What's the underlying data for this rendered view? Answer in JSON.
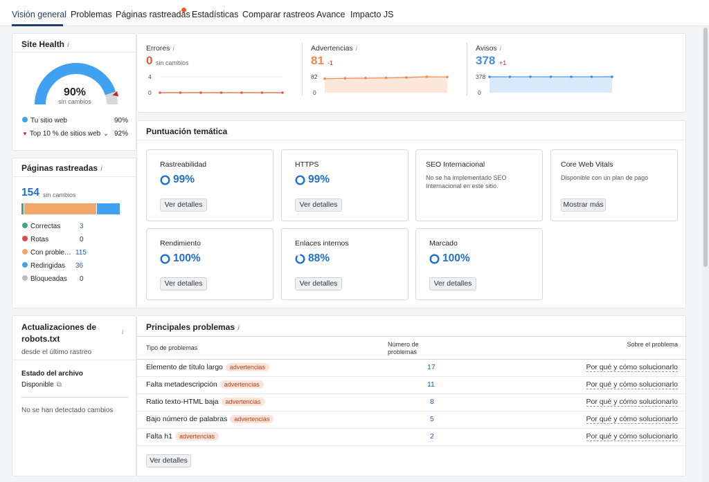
{
  "nav": {
    "tabs": [
      "Visión general",
      "Problemas",
      "Páginas rastreadas",
      "Estadísticas",
      "Comparar rastreos",
      "Avance",
      "Impacto JS"
    ]
  },
  "site_health": {
    "title": "Site Health",
    "info": "i",
    "value": "90%",
    "caption": "sin cambios",
    "your_site_label": "Tu sitio web",
    "your_site_value": "90%",
    "top10_label": "Top 10 % de sitios web",
    "top10_value": "92%",
    "gauge_fraction": 0.9,
    "colors": {
      "gauge": "#3fa1ef",
      "rest": "#d8d8d8",
      "marker": "#c9262c"
    }
  },
  "crawled_pages": {
    "title": "Páginas rastreadas",
    "info": "i",
    "total": "154",
    "caption": "sin cambios",
    "items": [
      {
        "label": "Correctas",
        "value": "3",
        "color": "#3ea67a",
        "link": true
      },
      {
        "label": "Rotas",
        "value": "0",
        "color": "#d94a4a",
        "link": false
      },
      {
        "label": "Con proble…",
        "value": "115",
        "color": "#f1a66c",
        "link": true
      },
      {
        "label": "Redirigidas",
        "value": "36",
        "color": "#3fa1ef",
        "link": true
      },
      {
        "label": "Bloqueadas",
        "value": "0",
        "color": "#bdbdbd",
        "link": false
      }
    ]
  },
  "robots": {
    "title_line1": "Actualizaciones de",
    "title_line2": "robots.txt",
    "info": "i",
    "subtitle": "desde el último rastreo",
    "file_state_label": "Estado del archivo",
    "file_state_value": "Disponible",
    "no_changes": "No se han detectado cambios"
  },
  "metrics": [
    {
      "label": "Errores",
      "info": "i",
      "value": "0",
      "delta": "sin cambios",
      "color": "#e65a3a",
      "y_ticks": [
        "4",
        "0"
      ],
      "points": [
        0,
        0,
        0,
        0,
        0,
        0,
        0
      ]
    },
    {
      "label": "Advertencias",
      "info": "i",
      "value": "81",
      "delta": "-1",
      "color": "#f08a4b",
      "y_ticks": [
        "82",
        "0"
      ],
      "points": [
        72,
        74,
        75,
        76,
        78,
        82,
        81
      ]
    },
    {
      "label": "Avisos",
      "info": "i",
      "value": "378",
      "delta": "+1",
      "color": "#3f8fe0",
      "y_ticks": [
        "378",
        "0"
      ],
      "points": [
        376,
        377,
        377,
        377,
        377,
        377,
        378
      ]
    }
  ],
  "thematic": {
    "title": "Puntuación temática",
    "tiles": [
      {
        "title": "Rastreabilidad",
        "value": "99%",
        "fraction": 0.99,
        "button": "Ver detalles"
      },
      {
        "title": "HTTPS",
        "value": "99%",
        "fraction": 0.99,
        "button": "Ver detalles"
      },
      {
        "title": "SEO Internacional",
        "desc": "No se ha implementado SEO Internacional en este sitio."
      },
      {
        "title": "Core Web Vitals",
        "desc": "Disponible con un plan de pago",
        "button": "Mostrar más"
      },
      {
        "title": "Rendimiento",
        "value": "100%",
        "fraction": 1.0,
        "button": "Ver detalles"
      },
      {
        "title": "Enlaces internos",
        "value": "88%",
        "fraction": 0.88,
        "button": "Ver detalles"
      },
      {
        "title": "Marcado",
        "value": "100%",
        "fraction": 1.0,
        "button": "Ver detalles"
      }
    ]
  },
  "issues": {
    "title": "Principales problemas",
    "info": "i",
    "col_type": "Tipo de problemas",
    "col_count_line1": "Número de",
    "col_count_line2": "problemas",
    "col_about": "Sobre el problema",
    "badge": "advertencias",
    "fix_link": "Por qué y cómo solucionarlo",
    "rows": [
      {
        "name": "Elemento de título largo",
        "count": "17"
      },
      {
        "name": "Falta metadescripción",
        "count": "11"
      },
      {
        "name": "Ratio texto-HTML baja",
        "count": "8"
      },
      {
        "name": "Bajo número de palabras",
        "count": "5"
      },
      {
        "name": "Falta h1",
        "count": "2"
      }
    ],
    "button": "Ver detalles"
  }
}
